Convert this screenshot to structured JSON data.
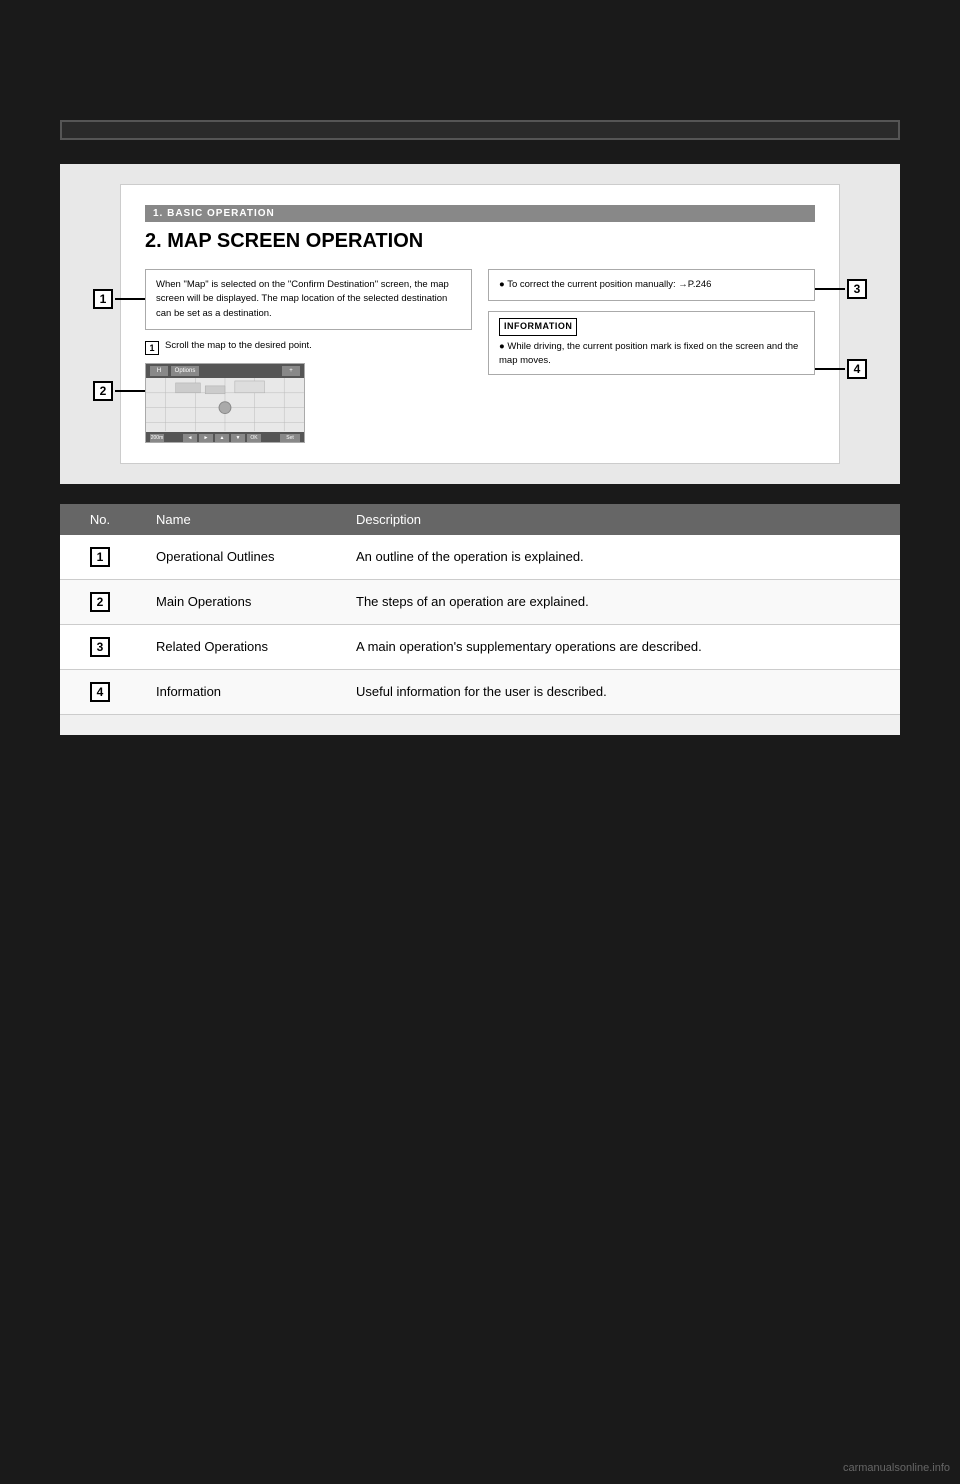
{
  "page": {
    "background": "#1a1a1a"
  },
  "header": {
    "bar_label": ""
  },
  "manual": {
    "section_label": "1. BASIC OPERATION",
    "title": "2. MAP SCREEN OPERATION",
    "text_box1": "When \"Map\" is selected on the \"Confirm Destination\" screen, the map screen will be displayed. The map location of the selected destination can be set as a destination.",
    "related_op_bullet": "● To correct the current position manually: →P.246",
    "info_label": "INFORMATION",
    "info_text": "● While driving, the current position mark is fixed on the screen and the map moves.",
    "step1_text": "Scroll the map to the desired point.",
    "indicators": {
      "num1": "1",
      "num2": "2",
      "num3": "3",
      "num4": "4"
    }
  },
  "table": {
    "headers": {
      "no": "No.",
      "name": "Name",
      "description": "Description"
    },
    "rows": [
      {
        "no": "1",
        "name": "Operational Outlines",
        "description": "An outline of the operation is explained."
      },
      {
        "no": "2",
        "name": "Main Operations",
        "description": "The steps of an operation are explained."
      },
      {
        "no": "3",
        "name": "Related Operations",
        "description": "A main operation's supplementary operations are described."
      },
      {
        "no": "4",
        "name": "Information",
        "description": "Useful information for the user is described."
      }
    ]
  },
  "watermark": "carmanualsonline.info"
}
